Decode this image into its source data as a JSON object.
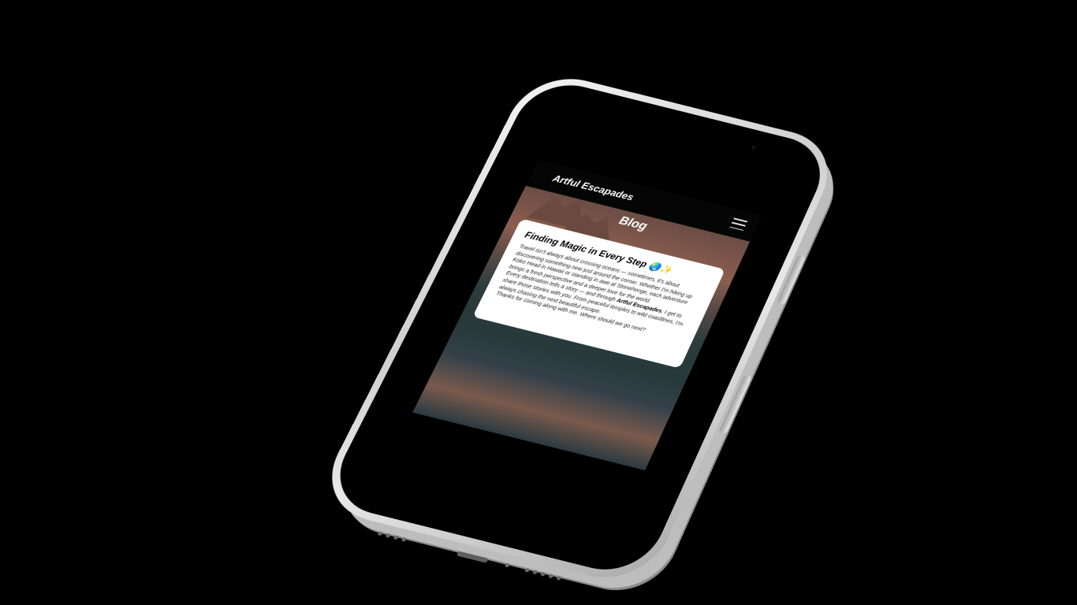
{
  "app": {
    "brand": "Artful Escapades",
    "menu_icon": "hamburger-menu-icon"
  },
  "page": {
    "heading": "Blog"
  },
  "post": {
    "title": "Finding Magic in Every Step",
    "title_emoji": "🌏✨",
    "paragraph1": "Travel isn't always about crossing oceans — sometimes, it's about discovering something new just around the corner. Whether I'm hiking up Koko Head in Hawaii or standing in awe at Stonehenge, each adventure brings a fresh perspective and a deeper love for the world.",
    "paragraph2_before": "Every destination tells a story — and through ",
    "paragraph2_bold": "Artful Escapades",
    "paragraph2_after": ", I get to share those stories with you. From peaceful temples to wild coastlines, I'm always chasing the next beautiful escape.",
    "paragraph3": "Thanks for coming along with me. Where should we go next?"
  },
  "colors": {
    "background": "#000000",
    "navbar": "#050505",
    "card": "#ffffff",
    "frame": "#d9d9d9"
  }
}
